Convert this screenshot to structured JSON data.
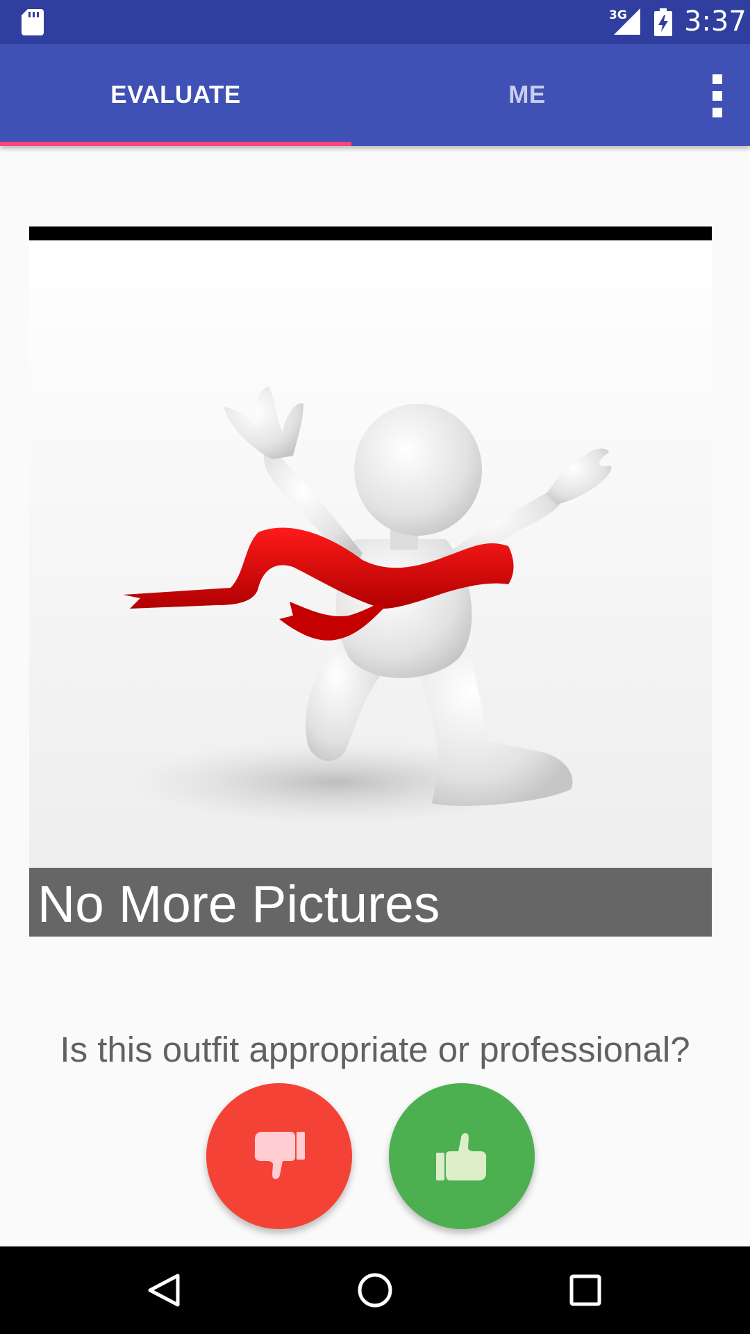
{
  "status_bar": {
    "time": "3:37",
    "network_type": "3G",
    "icons": [
      "sd-card-icon",
      "signal-icon",
      "battery-charging-icon"
    ]
  },
  "tabs": [
    {
      "label": "EVALUATE",
      "selected": true
    },
    {
      "label": "ME",
      "selected": false
    }
  ],
  "overflow_menu_icon": "more-vertical-icon",
  "picture": {
    "caption": "No More Pictures",
    "illustration": "finish-line-figure"
  },
  "question": "Is this outfit appropriate or professional?",
  "actions": {
    "dislike_icon": "thumbs-down-icon",
    "like_icon": "thumbs-up-icon",
    "dislike_color": "#f44336",
    "like_color": "#4caf50"
  },
  "nav_bar": {
    "icons": [
      "back-icon",
      "home-icon",
      "recents-icon"
    ]
  },
  "colors": {
    "primary": "#3f51b5",
    "primary_dark": "#303f9f",
    "accent": "#ff4081"
  }
}
